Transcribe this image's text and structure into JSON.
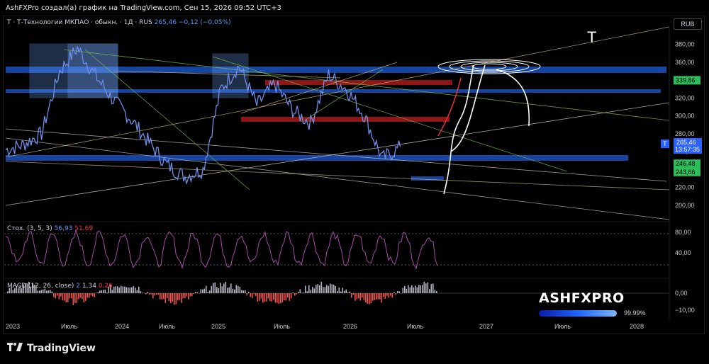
{
  "header": {
    "attribution": "AshFXPro создал(а) график на TradingView.com, Сен 15, 2026 09:52 UTC+3"
  },
  "legend": {
    "symbol": "Т · Т-Технологии МКПАО · обыкн. · 1Д · RUS",
    "last": "265,46",
    "change": "−0,12 (−0,05%)"
  },
  "currency": "RUB",
  "drawing_label": "T",
  "price_tags": {
    "level_upper": "339,86",
    "symbol_tag": "T",
    "current": "265,46",
    "countdown": "13:57:35",
    "level_mid": "246,48",
    "level_low": "243,66"
  },
  "stoch": {
    "label": "Стох.",
    "params": "(3, 5, 3)",
    "k": "56,93",
    "d": "51,69",
    "ticks": [
      "80,00",
      "40,00"
    ]
  },
  "macd": {
    "label": "MACD",
    "params": "(12, 26, close)",
    "v1": "2",
    "v2": "1,34",
    "v3": "0,26",
    "ticks": [
      "0,00",
      "−10,00"
    ]
  },
  "time_axis": [
    "2023",
    "Июль",
    "2024",
    "Июль",
    "2025",
    "Июль",
    "2026",
    "Июль",
    "2027",
    "Июль",
    "2028"
  ],
  "brand": {
    "name": "ASHFXPRO",
    "percent": "99.99%"
  },
  "footer": "TradingView",
  "colors": {
    "price_line": "#6f8ee6",
    "zone_blue": "#1e5bd6",
    "zone_red": "#b31b1b",
    "stoch": "#a64ca6",
    "macd_up": "#b2b5be",
    "macd_down": "#ef5350",
    "tag_green": "#2ebd5a",
    "tag_blue": "#2962ff"
  },
  "chart_data": {
    "type": "line",
    "title": "",
    "xlabel": "",
    "ylabel": "",
    "x_ticks": [
      "2023",
      "Июль",
      "2024",
      "Июль",
      "2025",
      "Июль",
      "2026",
      "Июль",
      "2027",
      "Июль",
      "2028"
    ],
    "y_ticks": [
      200,
      220,
      240,
      260,
      280,
      300,
      320,
      340,
      360,
      380
    ],
    "ylim": [
      188,
      398
    ],
    "x": [
      "2023-01",
      "2023-03",
      "2023-05",
      "2023-07",
      "2023-09",
      "2023-11",
      "2024-01",
      "2024-03",
      "2024-05",
      "2024-07",
      "2024-09",
      "2024-11",
      "2025-01",
      "2025-03",
      "2025-05",
      "2025-07",
      "2025-09",
      "2025-11",
      "2026-01",
      "2026-03",
      "2026-05",
      "2026-07",
      "2026-09"
    ],
    "series": [
      {
        "values": [
          262,
          268,
          280,
          350,
          376,
          345,
          318,
          296,
          270,
          245,
          232,
          240,
          330,
          356,
          312,
          336,
          306,
          292,
          346,
          330,
          300,
          252,
          265
        ]
      }
    ],
    "last_price": 265.46,
    "levels": [
      339.86,
      246.48,
      243.66
    ],
    "grid": false
  }
}
